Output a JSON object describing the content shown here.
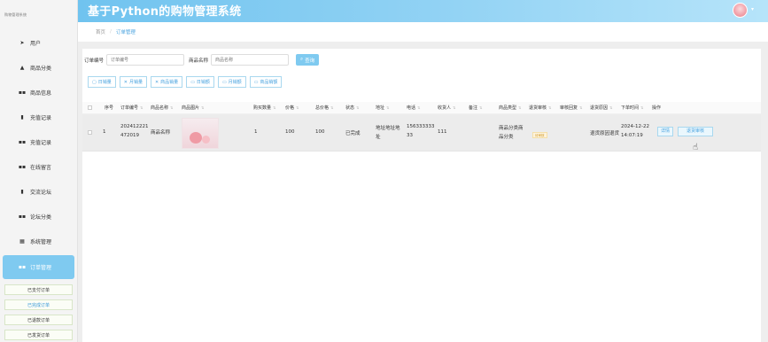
{
  "app": {
    "title": "基于Python的购物管理系统",
    "brand_label": "购物管理系统"
  },
  "sidebar": {
    "items": [
      {
        "label": "用户",
        "icon": "user-icon"
      },
      {
        "label": "商品分类",
        "icon": "category-icon"
      },
      {
        "label": "商品信息",
        "icon": "grid-icon"
      },
      {
        "label": "充值记录",
        "icon": "bar-chart-icon"
      },
      {
        "label": "充值记录",
        "icon": "grid-icon"
      },
      {
        "label": "在线留言",
        "icon": "grid-icon"
      },
      {
        "label": "交流论坛",
        "icon": "doc-icon"
      },
      {
        "label": "论坛分类",
        "icon": "grid-icon"
      },
      {
        "label": "系统管理",
        "icon": "settings-grid-icon"
      },
      {
        "label": "订单管理",
        "icon": "grid-icon"
      }
    ],
    "sub_items": [
      "已支付订单",
      "已完成订单",
      "已退款订单",
      "已发货订单"
    ]
  },
  "breadcrumb": {
    "home": "首页",
    "separator": "/",
    "current": "订单管理"
  },
  "search": {
    "order_no_label": "订单编号",
    "order_no_placeholder": "订单编号",
    "product_name_label": "商品名称",
    "product_name_placeholder": "商品名称",
    "query_label": "查询"
  },
  "stats_buttons": [
    "日销量",
    "月销量",
    "商品销量",
    "日销额",
    "月销额",
    "商品销额"
  ],
  "table": {
    "columns": [
      "序号",
      "订单编号",
      "商品名称",
      "商品图片",
      "购买数量",
      "价格",
      "总价格",
      "状态",
      "地址",
      "电话",
      "收货人",
      "备注",
      "商品类型",
      "退货审核",
      "审核回复",
      "退货原因",
      "下单时间",
      "操作"
    ],
    "rows": [
      {
        "index": "1",
        "order_no_l1": "202412221",
        "order_no_l2": "472019",
        "product_name": "商品名称",
        "quantity": "1",
        "price": "100",
        "total": "100",
        "status": "已完成",
        "address_l1": "地址地址地",
        "address_l2": "址",
        "phone_l1": "156333333",
        "phone_l2": "33",
        "receiver": "111",
        "product_type_l1": "商品分类商",
        "product_type_l2": "品分类",
        "return_review": "待审核",
        "return_reason": "退货原因退货",
        "order_time_l1": "2024-12-22",
        "order_time_l2": "14:07:19",
        "action_detail": "详情",
        "action_return": "退货审核"
      }
    ]
  },
  "colors": {
    "accent": "#7fcaf0",
    "header_start": "#70c3ef",
    "header_end": "#b6e4fa",
    "link": "#4aa3df"
  }
}
